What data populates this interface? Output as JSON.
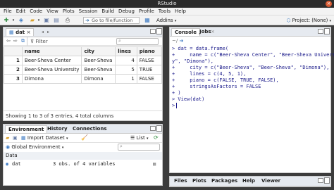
{
  "window": {
    "title": "RStudio",
    "close_glyph": "×"
  },
  "menu": [
    "File",
    "Edit",
    "Code",
    "View",
    "Plots",
    "Session",
    "Build",
    "Debug",
    "Profile",
    "Tools",
    "Help"
  ],
  "toolbar": {
    "goto_placeholder": "Go to file/function",
    "addins_label": "Addins",
    "project_label": "Project: (None)"
  },
  "viewer": {
    "tab_label": "dat",
    "filter_label": "Filter",
    "columns": [
      "name",
      "city",
      "lines",
      "piano"
    ],
    "rows": [
      {
        "idx": "1",
        "name": "Beer-Sheva Center",
        "city": "Beer-Sheva",
        "lines": "4",
        "piano": "FALSE"
      },
      {
        "idx": "2",
        "name": "Beer-Sheva University",
        "city": "Beer-Sheva",
        "lines": "5",
        "piano": "TRUE"
      },
      {
        "idx": "3",
        "name": "Dimona",
        "city": "Dimona",
        "lines": "1",
        "piano": "FALSE"
      }
    ],
    "status": "Showing 1 to 3 of 3 entries, 4 total columns"
  },
  "env": {
    "tabs": [
      "Environment",
      "History",
      "Connections"
    ],
    "import_label": "Import Dataset",
    "list_label": "List",
    "global_env_label": "Global Environment",
    "section_label": "Data",
    "row_name": "dat",
    "row_value": "3 obs. of 4 variables"
  },
  "console": {
    "tabs": [
      "Console",
      "Jobs"
    ],
    "path": "~/",
    "lines": [
      "> dat = data.frame(",
      "+     name = c(\"Beer-Sheva Center\", \"Beer-Sheva Universit",
      "y\", \"Dimona\"),",
      "+     city = c(\"Beer-Sheva\", \"Beer-Sheva\", \"Dimona\"),",
      "+     lines = c(4, 5, 1),",
      "+     piano = c(FALSE, TRUE, FALSE),",
      "+     stringsAsFactors = FALSE",
      "+ )",
      "> View(dat)",
      ">"
    ]
  },
  "files": {
    "tabs": [
      "Files",
      "Plots",
      "Packages",
      "Help",
      "Viewer"
    ]
  }
}
